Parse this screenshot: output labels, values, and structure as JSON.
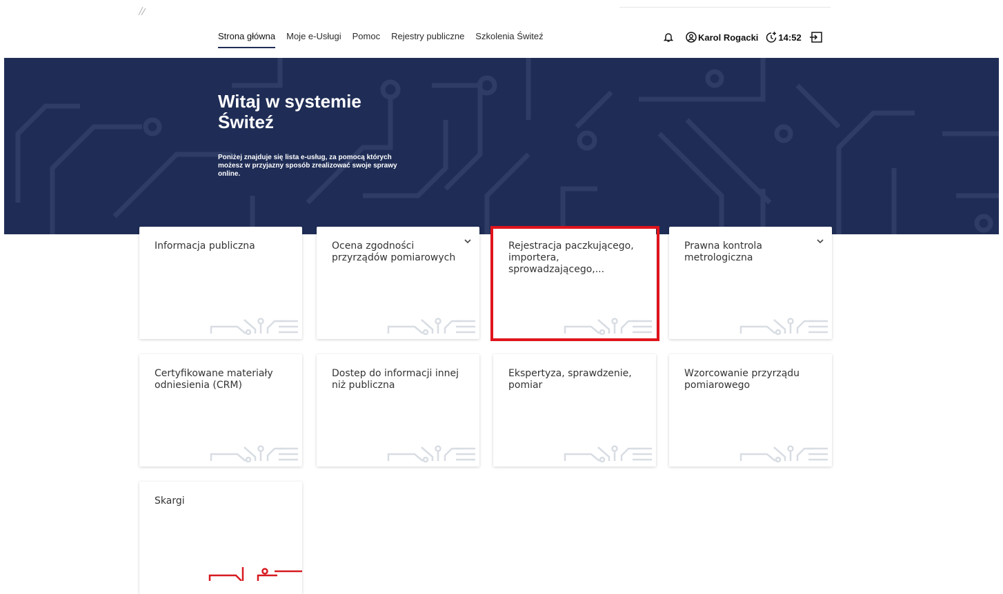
{
  "nav": {
    "items": [
      {
        "label": "Strona główna",
        "active": true
      },
      {
        "label": "Moje e-Usługi"
      },
      {
        "label": "Pomoc"
      },
      {
        "label": "Rejestry publiczne"
      },
      {
        "label": "Szkolenia Świteź"
      }
    ]
  },
  "user": {
    "name": "Karol Rogacki",
    "session_time": "14:52"
  },
  "hero": {
    "title": "Witaj w systemie Świteź",
    "text": "Poniżej znajduje się lista e-usług, za pomocą których możesz w przyjazny sposób zrealizować swoje sprawy online."
  },
  "cards": [
    {
      "label": "Informacja publiczna"
    },
    {
      "label": "Ocena zgodności przyrządów pomiarowych"
    },
    {
      "label": "Rejestracja paczkującego, importera, sprowadzającego,..."
    },
    {
      "label": "Prawna kontrola metrologiczna"
    },
    {
      "label": "Certyfikowane materiały odniesienia (CRM)"
    },
    {
      "label": "Dostep do informacji innej niż publiczna"
    },
    {
      "label": "Ekspertyza, sprawdzenie, pomiar"
    },
    {
      "label": "Wzorcowanie przyrządu pomiarowego"
    },
    {
      "label": "Skargi"
    }
  ],
  "icons": {
    "bell": "bell-icon",
    "user": "user-circle-icon",
    "timer": "session-timer-icon",
    "logout": "logout-icon",
    "chevron": "chevron-down-icon"
  },
  "colors": {
    "hero_bg": "#1f2d56",
    "highlight": "#e0141c",
    "deco": "#d8dde3",
    "deco_active": "#d71920"
  }
}
